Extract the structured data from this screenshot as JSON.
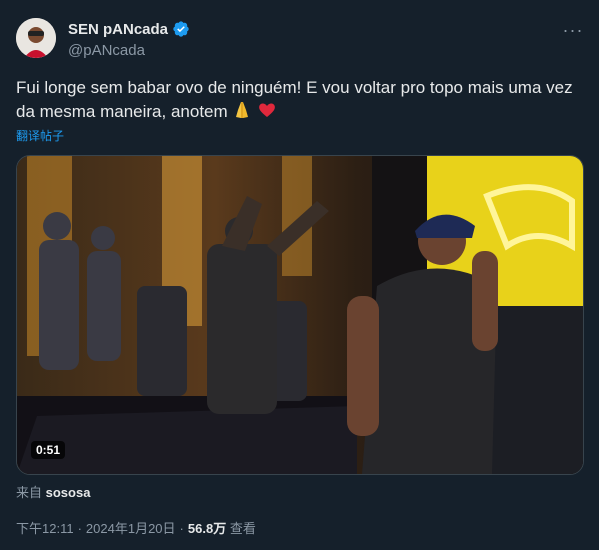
{
  "author": {
    "display_name": "SEN pANcada",
    "handle": "@pANcada",
    "verified_color": "#1d9bf0"
  },
  "menu": {
    "more_label": "···"
  },
  "tweet": {
    "text_line1": "Fui longe sem babar ovo de ninguém! E vou voltar pro topo mais uma vez",
    "text_line2": "da mesma maneira, anotem",
    "emoji_hands": "🙏",
    "emoji_heart": "❤️",
    "translate_label": "翻译帖子"
  },
  "media": {
    "duration": "0:51",
    "accent_color": "#e8d21a"
  },
  "source": {
    "prefix": "来自",
    "name": "sososa"
  },
  "meta": {
    "time": "下午12:11",
    "date": "2024年1月20日",
    "views_count": "56.8万",
    "views_label": "查看"
  }
}
